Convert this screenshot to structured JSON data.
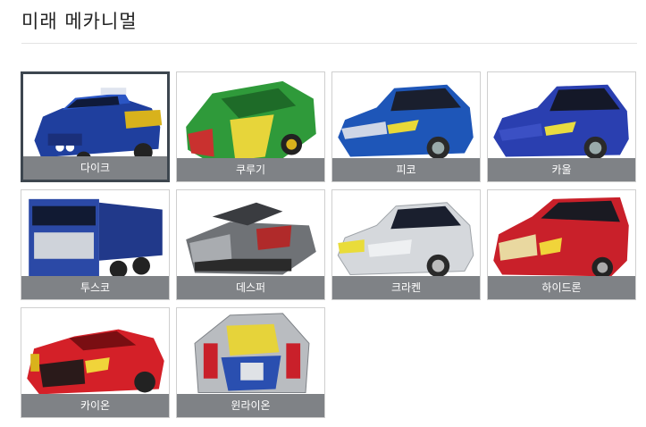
{
  "page": {
    "title": "미래 메카니멀"
  },
  "cards": [
    {
      "label": "다이크",
      "color": "#1f3f9e",
      "selected": true
    },
    {
      "label": "쿠루기",
      "color": "#2f9a3a",
      "selected": false
    },
    {
      "label": "피코",
      "color": "#1e56b8",
      "selected": false
    },
    {
      "label": "카울",
      "color": "#2a3fb0",
      "selected": false
    },
    {
      "label": "투스코",
      "color": "#2b49a6",
      "selected": false
    },
    {
      "label": "데스퍼",
      "color": "#6f7276",
      "selected": false
    },
    {
      "label": "크라켄",
      "color": "#c9cdd1",
      "selected": false
    },
    {
      "label": "하이드론",
      "color": "#c9202a",
      "selected": false
    },
    {
      "label": "카이온",
      "color": "#d42028",
      "selected": false
    },
    {
      "label": "윈라이온",
      "color": "#b9bcc0",
      "selected": false
    }
  ]
}
